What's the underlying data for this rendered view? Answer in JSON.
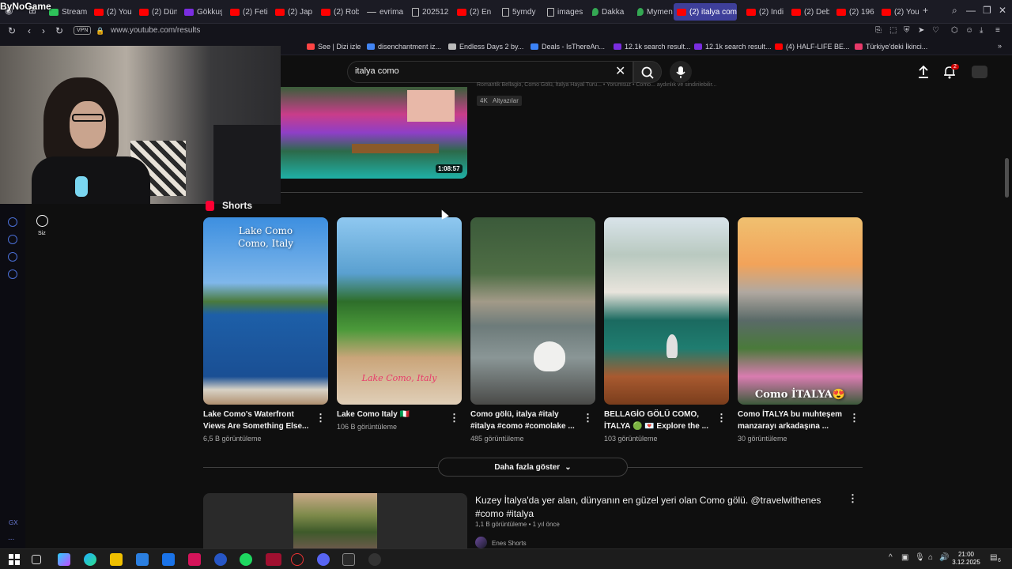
{
  "watermark": "ByNoGame",
  "browser": {
    "tabs": [
      {
        "label": "Stream",
        "icon": "green"
      },
      {
        "label": "(2) You",
        "icon": "yt"
      },
      {
        "label": "(2) Dün",
        "icon": "yt"
      },
      {
        "label": "Gökkuş",
        "icon": "s"
      },
      {
        "label": "(2) Feti",
        "icon": "yt"
      },
      {
        "label": "(2) Jap",
        "icon": "yt"
      },
      {
        "label": "(2) Rob",
        "icon": "yt"
      },
      {
        "label": "evrima",
        "icon": "dash"
      },
      {
        "label": "202512",
        "icon": "doc"
      },
      {
        "label": "(2) En",
        "icon": "yt"
      },
      {
        "label": "5ymdy",
        "icon": "doc"
      },
      {
        "label": "images",
        "icon": "doc"
      },
      {
        "label": "Dakka",
        "icon": "map"
      },
      {
        "label": "Mymen",
        "icon": "map"
      },
      {
        "label": "(2) italya como",
        "icon": "yt",
        "active": true
      },
      {
        "label": "(2) Indi",
        "icon": "yt"
      },
      {
        "label": "(2) Deb",
        "icon": "yt"
      },
      {
        "label": "(2) 196",
        "icon": "yt"
      },
      {
        "label": "(2) You",
        "icon": "yt"
      }
    ],
    "vpn_label": "VPN",
    "url": "www.youtube.com/results",
    "bookmarks": [
      {
        "label": "See | Dizi izle",
        "color": "#ff4444"
      },
      {
        "label": "disenchantment iz...",
        "color": "#4285f4"
      },
      {
        "label": "Endless Days 2 by...",
        "color": "#bbbbbb"
      },
      {
        "label": "Deals - IsThereAn...",
        "color": "#3b82f6"
      },
      {
        "label": "12.1k search result...",
        "color": "#7a2de0"
      },
      {
        "label": "12.1k search result...",
        "color": "#7a2de0"
      },
      {
        "label": "(4) HALF-LIFE BE...",
        "color": "#ff0000"
      },
      {
        "label": "Türkiye'deki İkinci...",
        "color": "#e83a6a"
      }
    ]
  },
  "youtube": {
    "search_query": "italya como",
    "notification_count": "2",
    "siz_label": "Siz",
    "top_video": {
      "duration": "1:08:57",
      "desc": "Romantik Bellagio, Como Gölü, İtalya Hayal Turu... • Yorumsuz • Como... aydınlık ve sindirilebilir...",
      "chips": [
        "4K",
        "Altyazılar"
      ]
    },
    "shorts_heading": "Shorts",
    "shorts": [
      {
        "title": "Lake Como's Waterfront Views Are Something Else...",
        "views": "6,5 B görüntüleme",
        "overlay1": "Lake Como",
        "overlay2": "Como, Italy"
      },
      {
        "title": "Lake Como Italy 🇮🇹",
        "views": "106 B görüntüleme",
        "overlay1": "Lake Como, Italy"
      },
      {
        "title": "Como gölü, italya #italy #italya #como #comolake ...",
        "views": "485 görüntüleme"
      },
      {
        "title": "BELLAGİO GÖLÜ COMO, İTALYA 🟢 💌 Explore the ...",
        "views": "103 görüntüleme"
      },
      {
        "title": "Como İTALYA bu muhteşem manzarayı arkadaşına ...",
        "views": "30 görüntüleme",
        "overlay1": "Como İTALYA😍"
      }
    ],
    "show_more": "Daha fazla göster",
    "bottom_video": {
      "title": "Kuzey İtalya'da yer alan, dünyanın en güzel yeri olan Como gölü. @travelwithenes #como #italya",
      "meta": "1,1 B görüntüleme • 1 yıl önce",
      "channel": "Enes Shorts"
    }
  },
  "rail": {
    "gx_label": "GX",
    "more_label": "..."
  },
  "taskbar": {
    "time": "21:00",
    "date": "3.12.2025",
    "notif": "6"
  }
}
